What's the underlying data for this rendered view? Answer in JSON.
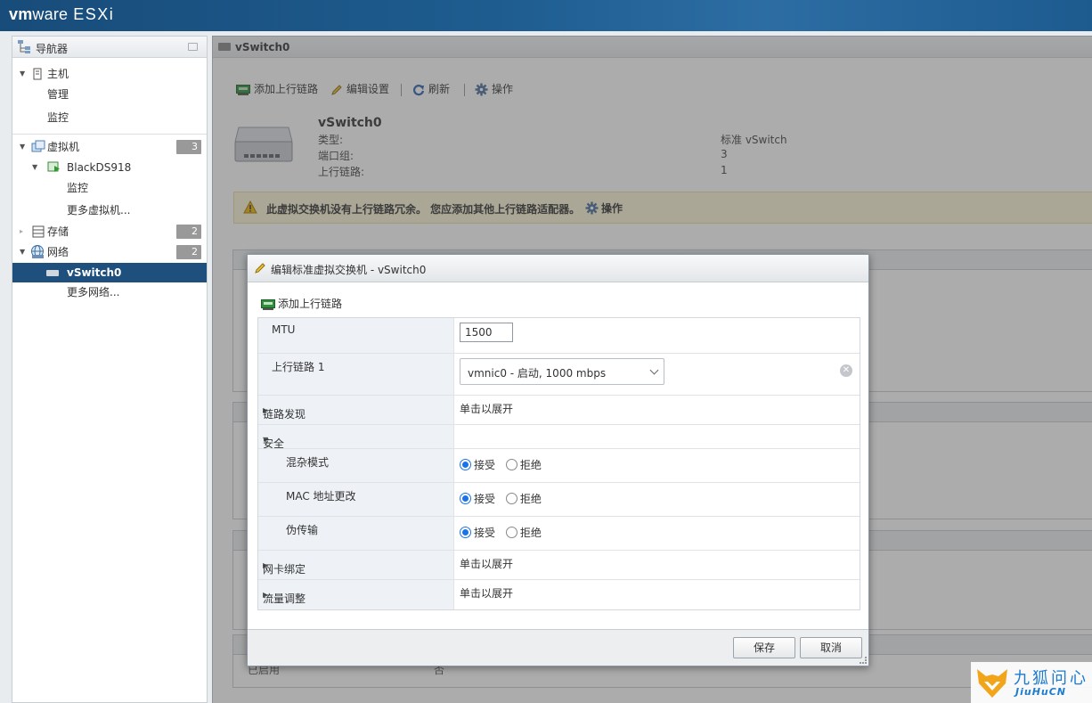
{
  "app": {
    "brand_vm": "vm",
    "brand_ware": "ware",
    "product": "ESXi"
  },
  "navigator": {
    "title": "导航器",
    "host": {
      "label": "主机",
      "children": [
        "管理",
        "监控"
      ]
    },
    "vms": {
      "label": "虚拟机",
      "count": "3",
      "vm_name": "BlackDS918",
      "vm_children": [
        "监控"
      ],
      "more": "更多虚拟机..."
    },
    "storage": {
      "label": "存储",
      "count": "2"
    },
    "network": {
      "label": "网络",
      "count": "2",
      "selected": "vSwitch0",
      "more": "更多网络..."
    }
  },
  "main": {
    "header_title": "vSwitch0",
    "toolbar": {
      "add_uplink": "添加上行链路",
      "edit_settings": "编辑设置",
      "refresh": "刷新",
      "actions": "操作"
    },
    "switch_name": "vSwitch0",
    "details": [
      {
        "key": "类型:",
        "value": "标准 vSwitch"
      },
      {
        "key": "端口组:",
        "value": "3"
      },
      {
        "key": "上行链路:",
        "value": "1"
      }
    ],
    "warning": {
      "text": "此虚拟交换机没有上行链路冗余。 您应添加其他上行链路适配器。",
      "action": "操作"
    },
    "bg_fragment_1": "已启用",
    "bg_fragment_2": "否"
  },
  "dialog": {
    "title": "编辑标准虚拟交换机 - vSwitch0",
    "add_uplink": "添加上行链路",
    "mtu": {
      "label": "MTU",
      "value": "1500"
    },
    "uplink1": {
      "label": "上行链路 1",
      "selected": "vmnic0 - 启动, 1000 mbps"
    },
    "link_discovery": {
      "label": "链路发现",
      "value": "单击以展开"
    },
    "security": {
      "label": "安全",
      "accept": "接受",
      "reject": "拒绝",
      "promiscuous": "混杂模式",
      "mac_change": "MAC 地址更改",
      "forged": "伪传输"
    },
    "nic_teaming": {
      "label": "网卡绑定",
      "value": "单击以展开"
    },
    "traffic_shaping": {
      "label": "流量调整",
      "value": "单击以展开"
    },
    "save": "保存",
    "cancel": "取消"
  },
  "watermark": {
    "text": "九狐问心",
    "sub": "JiuHuCN"
  },
  "colors": {
    "header": "#1e5c8f",
    "selected": "#1e4f7d",
    "radio": "#1a73e8",
    "warning_bg": "#fdf6d8"
  }
}
